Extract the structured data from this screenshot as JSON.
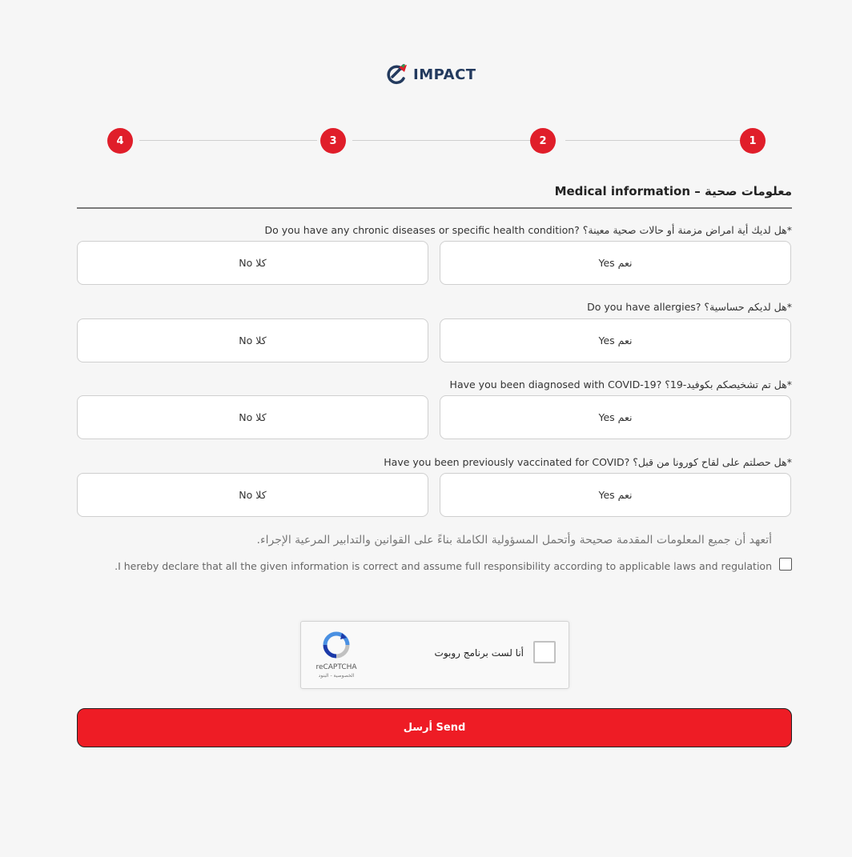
{
  "brand": {
    "name": "IMPACT",
    "colors": {
      "primary": "#e01e2a",
      "navy": "#233a5e",
      "send_button": "#ee1c25"
    }
  },
  "stepper": {
    "steps": [
      "4",
      "3",
      "2",
      "1"
    ],
    "active": "1"
  },
  "section": {
    "title": "Medical information – معلومات صحية"
  },
  "questions": [
    {
      "label": "Do you have any chronic diseases or specific health condition? هل لديك أية امراض مزمنة أو حالات صحية معينة؟*",
      "no_label": "No كلا",
      "yes_label": "Yes نعم"
    },
    {
      "label": "Do you have allergies? هل لديكم حساسية؟*",
      "no_label": "No كلا",
      "yes_label": "Yes نعم"
    },
    {
      "label": "Have you been diagnosed with COVID-19? هل تم تشخيصكم بكوفيد-19؟*",
      "no_label": "No كلا",
      "yes_label": "Yes نعم"
    },
    {
      "label": "Have you been previously vaccinated for COVID? هل حصلتم على لقاح كورونا من قبل؟*",
      "no_label": "No كلا",
      "yes_label": "Yes نعم"
    }
  ],
  "declaration": {
    "arabic": "أتعهد أن جميع المعلومات المقدمة صحيحة وأتحمل المسؤولية الكاملة بناءً على القوانين والتدابير المرعية الإجراء.",
    "english": "I hereby declare that all the given information is correct and assume full responsibility according to applicable laws and regulation.",
    "checked": false
  },
  "recaptcha": {
    "label": "أنا لست برنامج روبوت",
    "brand": "reCAPTCHA",
    "links": "الخصوصية - البنود"
  },
  "submit": {
    "label": "أرسل Send"
  }
}
